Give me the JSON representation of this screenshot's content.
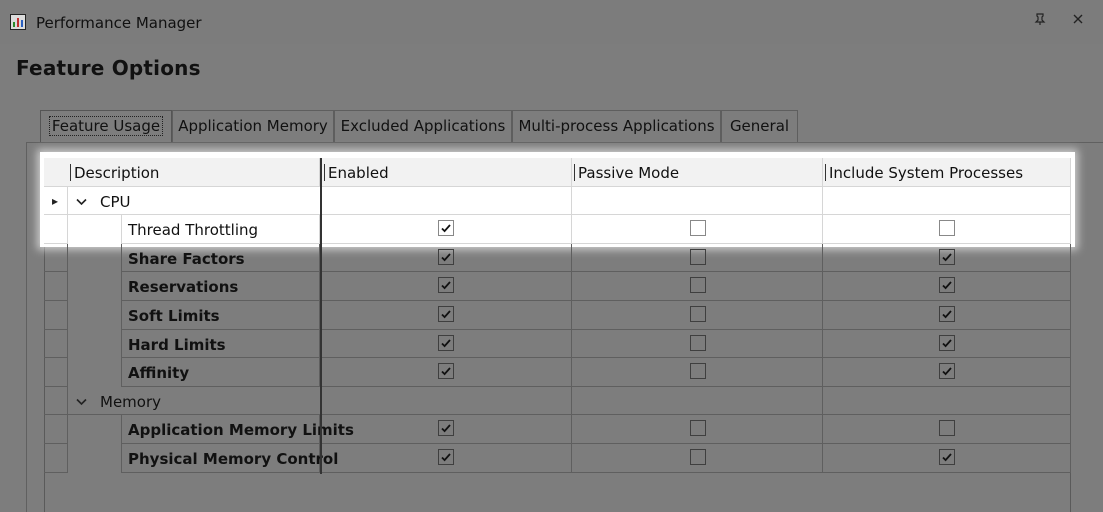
{
  "window": {
    "title": "Performance Manager",
    "pin_icon": "pin-icon",
    "close_icon": "close-icon"
  },
  "page": {
    "heading": "Feature Options"
  },
  "tabs": [
    {
      "label": "Feature Usage",
      "active": true
    },
    {
      "label": "Application Memory",
      "active": false
    },
    {
      "label": "Excluded Applications",
      "active": false
    },
    {
      "label": "Multi-process Applications",
      "active": false
    },
    {
      "label": "General",
      "active": false
    }
  ],
  "grid": {
    "columns": [
      "Description",
      "Enabled",
      "Passive Mode",
      "Include System Processes"
    ],
    "groups": [
      {
        "name": "CPU",
        "rows": [
          {
            "label": "Thread Throttling",
            "enabled": true,
            "passive": false,
            "system": false
          },
          {
            "label": "Share Factors",
            "enabled": true,
            "passive": false,
            "system": true
          },
          {
            "label": "Reservations",
            "enabled": true,
            "passive": false,
            "system": true
          },
          {
            "label": "Soft Limits",
            "enabled": true,
            "passive": false,
            "system": true
          },
          {
            "label": "Hard Limits",
            "enabled": true,
            "passive": false,
            "system": true
          },
          {
            "label": "Affinity",
            "enabled": true,
            "passive": false,
            "system": true
          }
        ]
      },
      {
        "name": "Memory",
        "rows": [
          {
            "label": "Application Memory Limits",
            "enabled": true,
            "passive": false,
            "system": false
          },
          {
            "label": "Physical Memory Control",
            "enabled": true,
            "passive": false,
            "system": true
          }
        ]
      }
    ]
  },
  "colors": {
    "background": "#7d7d7d",
    "highlight": "#ffffff"
  }
}
